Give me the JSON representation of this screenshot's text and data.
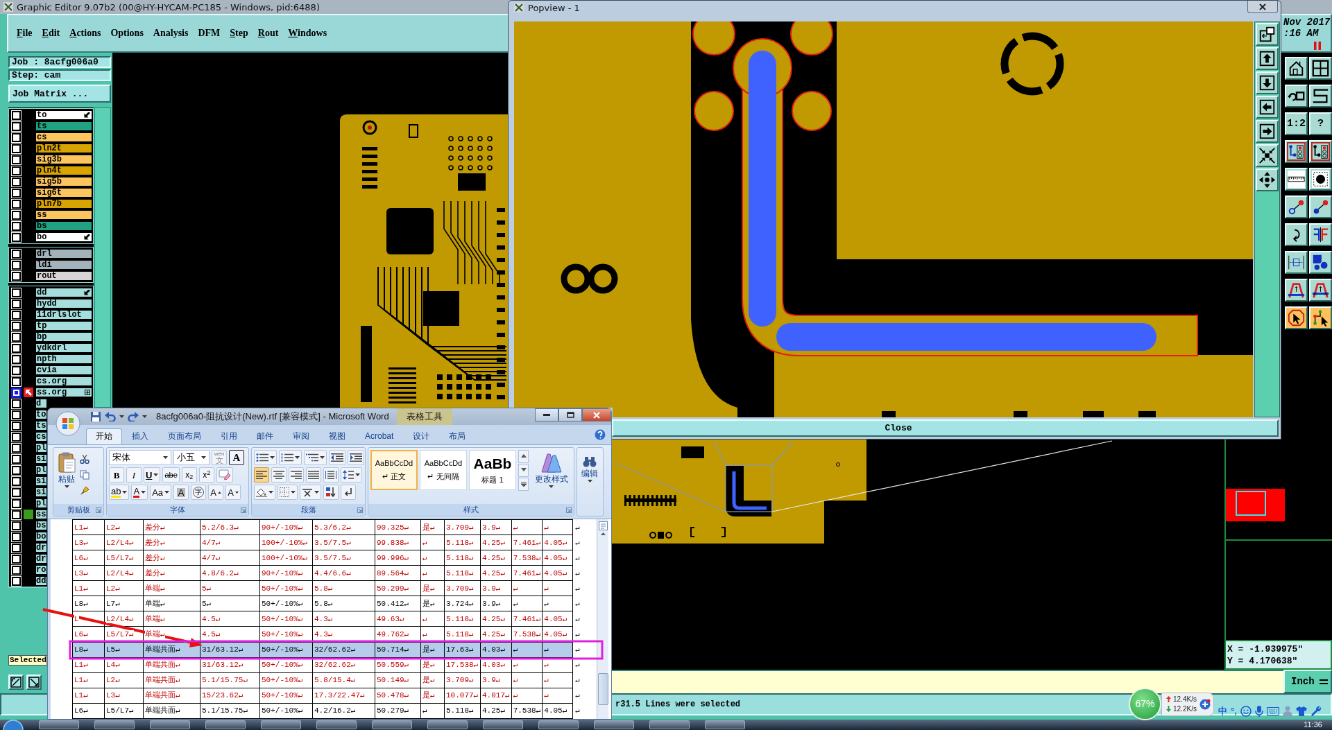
{
  "editor": {
    "title": "Graphic Editor 9.07b2 (00@HY-HYCAM-PC185 - Windows, pid:6488)",
    "menu": [
      {
        "label": "File",
        "mnemonic": true
      },
      {
        "label": "Edit",
        "mnemonic": true
      },
      {
        "label": "Actions",
        "mnemonic": true
      },
      {
        "label": "Options",
        "mnemonic": false
      },
      {
        "label": "Analysis",
        "mnemonic": false
      },
      {
        "label": "DFM",
        "mnemonic": false
      },
      {
        "label": "Step",
        "mnemonic": true
      },
      {
        "label": "Rout",
        "mnemonic": true
      },
      {
        "label": "Windows",
        "mnemonic": true
      }
    ],
    "clock": [
      "Nov 2017",
      ":16 AM"
    ],
    "job": "Job : 8acfg006a0",
    "step": "Step: cam",
    "job_matrix_button": "Job Matrix ...",
    "layer_groups": [
      {
        "layers": [
          {
            "name": "to",
            "color": "#ffffff",
            "affected": false,
            "kind": "pinned"
          },
          {
            "name": "ts",
            "color": "#1fa382",
            "affected": false,
            "kind": "plain"
          },
          {
            "name": "cs",
            "color": "#fdc55e",
            "affected": false,
            "kind": "plain"
          },
          {
            "name": "pln2t",
            "color": "#d9a400",
            "affected": false,
            "kind": "plain"
          },
          {
            "name": "sig3b",
            "color": "#fdc55e",
            "affected": false,
            "kind": "plain"
          },
          {
            "name": "pln4t",
            "color": "#d9a400",
            "affected": false,
            "kind": "plain"
          },
          {
            "name": "sig5b",
            "color": "#fdc55e",
            "affected": false,
            "kind": "plain"
          },
          {
            "name": "sig6t",
            "color": "#fdc55e",
            "affected": false,
            "kind": "plain"
          },
          {
            "name": "pln7b",
            "color": "#d9a400",
            "affected": false,
            "kind": "plain"
          },
          {
            "name": "ss",
            "color": "#fdc55e",
            "affected": false,
            "kind": "plain"
          },
          {
            "name": "bs",
            "color": "#1fa382",
            "affected": false,
            "kind": "plain"
          },
          {
            "name": "bo",
            "color": "#ffffff",
            "affected": false,
            "kind": "pinned"
          }
        ]
      },
      {
        "layers": [
          {
            "name": "drl",
            "color": "#a3b3bb",
            "affected": false,
            "kind": "plain"
          },
          {
            "name": "ldi",
            "color": "#a3b3bb",
            "affected": false,
            "kind": "plain"
          },
          {
            "name": "rout",
            "color": "#d6d6d6",
            "affected": false,
            "kind": "plain"
          }
        ]
      },
      {
        "layers": [
          {
            "name": "dd",
            "color": "#a6dede",
            "affected": false,
            "kind": "pinned"
          },
          {
            "name": "hydd",
            "color": "#a6dede",
            "affected": false,
            "kind": "plain"
          },
          {
            "name": "11drlslot",
            "color": "#a6dede",
            "affected": false,
            "kind": "plain"
          },
          {
            "name": "tp",
            "color": "#a6dede",
            "affected": false,
            "kind": "plain"
          },
          {
            "name": "bp",
            "color": "#a6dede",
            "affected": false,
            "kind": "plain"
          },
          {
            "name": "ydkdrl",
            "color": "#a6dede",
            "affected": false,
            "kind": "plain"
          },
          {
            "name": "npth",
            "color": "#a6dede",
            "affected": false,
            "kind": "plain"
          },
          {
            "name": "cvia",
            "color": "#a6dede",
            "affected": false,
            "kind": "plain"
          },
          {
            "name": "cs.org",
            "color": "#a6dede",
            "affected": false,
            "kind": "plain"
          },
          {
            "name": "ss.org",
            "color": "#a6dede",
            "affected": true,
            "kind": "work"
          },
          {
            "name": "d",
            "color": "#a6dede",
            "affected": false,
            "kind": "plain"
          },
          {
            "name": "to",
            "color": "#a6dede",
            "affected": false,
            "kind": "plain"
          },
          {
            "name": "ts",
            "color": "#a6dede",
            "affected": false,
            "kind": "plain"
          },
          {
            "name": "cs",
            "color": "#a6dede",
            "affected": false,
            "kind": "plain"
          },
          {
            "name": "pl",
            "color": "#a6dede",
            "affected": false,
            "kind": "plain"
          },
          {
            "name": "si",
            "color": "#a6dede",
            "affected": false,
            "kind": "plain"
          },
          {
            "name": "pl",
            "color": "#a6dede",
            "affected": false,
            "kind": "plain"
          },
          {
            "name": "si",
            "color": "#a6dede",
            "affected": false,
            "kind": "plain"
          },
          {
            "name": "si",
            "color": "#a6dede",
            "affected": false,
            "kind": "plain"
          },
          {
            "name": "pl",
            "color": "#a6dede",
            "affected": false,
            "kind": "plain"
          },
          {
            "name": "ss",
            "color": "#a6dede",
            "affected": false,
            "kind": "shown"
          },
          {
            "name": "bs",
            "color": "#a6dede",
            "affected": false,
            "kind": "plain"
          },
          {
            "name": "bo",
            "color": "#a6dede",
            "affected": false,
            "kind": "plain"
          },
          {
            "name": "dr",
            "color": "#a6dede",
            "affected": false,
            "kind": "plain"
          },
          {
            "name": "dr",
            "color": "#a6dede",
            "affected": false,
            "kind": "plain"
          },
          {
            "name": "ro",
            "color": "#a6dede",
            "affected": false,
            "kind": "plain"
          },
          {
            "name": "dd",
            "color": "#a6dede",
            "affected": false,
            "kind": "plain"
          }
        ]
      }
    ],
    "selected_label": "Selected",
    "tools": [
      {
        "kind": "icon",
        "on": false
      },
      {
        "kind": "icon",
        "on": false
      },
      {
        "kind": "icon",
        "on": false
      },
      {
        "kind": "icon",
        "on": false
      },
      {
        "kind": "text",
        "label": "1:2",
        "on": false
      },
      {
        "kind": "text",
        "label": "?",
        "on": false
      },
      {
        "kind": "icon",
        "on": false
      },
      {
        "kind": "icon",
        "on": false
      },
      {
        "kind": "icon",
        "on": false
      },
      {
        "kind": "icon",
        "on": false
      },
      {
        "kind": "icon",
        "on": false
      },
      {
        "kind": "icon",
        "on": false
      },
      {
        "kind": "icon",
        "on": false
      },
      {
        "kind": "icon",
        "on": false
      },
      {
        "kind": "icon",
        "on": false
      },
      {
        "kind": "icon",
        "on": false
      },
      {
        "kind": "icon",
        "on": false
      },
      {
        "kind": "icon",
        "on": false
      },
      {
        "kind": "icon",
        "on": true
      },
      {
        "kind": "icon",
        "on": true
      }
    ],
    "coordinates": [
      "X = -1.939975\"",
      "Y = 4.170638\""
    ],
    "units_button": "Inch",
    "status": "r31.5 Lines were selected"
  },
  "popview": {
    "title": "Popview - 1",
    "close_button": "Close"
  },
  "word": {
    "title": "8acfg006a0-阻抗设计(New).rtf [兼容模式] - Microsoft Word",
    "context_tab": "表格工具",
    "tabs": [
      {
        "label": "开始",
        "selected": true
      },
      {
        "label": "插入",
        "selected": false
      },
      {
        "label": "页面布局",
        "selected": false
      },
      {
        "label": "引用",
        "selected": false
      },
      {
        "label": "邮件",
        "selected": false
      },
      {
        "label": "审阅",
        "selected": false
      },
      {
        "label": "视图",
        "selected": false
      },
      {
        "label": "Acrobat",
        "selected": false
      },
      {
        "label": "设计",
        "selected": false
      },
      {
        "label": "布局",
        "selected": false
      }
    ],
    "clipboard": {
      "title": "剪贴板",
      "paste": "粘贴"
    },
    "font": {
      "title": "字体",
      "name": "宋体",
      "size": "小五",
      "phonetic": [
        "wén",
        "文"
      ],
      "border_char": "A",
      "row2": [
        "B",
        "I",
        "U",
        "abe",
        "x$_{2}$",
        "x$^{2}$"
      ],
      "row3": [
        "ab",
        "A",
        "Aa",
        "A",
        "字",
        "A",
        "A"
      ]
    },
    "paragraph": {
      "title": "段落",
      "align": [
        {
          "selected": true
        },
        {
          "selected": false
        },
        {
          "selected": false
        },
        {
          "selected": false
        },
        {
          "selected": false
        }
      ]
    },
    "styles": {
      "title": "样式",
      "items": [
        {
          "sample": "AaBbCcDd",
          "name": "↵ 正文",
          "selected": true
        },
        {
          "sample": "AaBbCcDd",
          "name": "↵ 无间隔",
          "selected": false
        },
        {
          "sample": "AaBb",
          "name": "标题 1",
          "selected": false
        }
      ],
      "change": "更改样式"
    },
    "editing": "编辑",
    "table": {
      "rows": [
        {
          "cells": [
            "L1↵",
            "L2↵",
            "差分↵",
            "5.2/6.3↵",
            "90+/-10%↵",
            "5.3/6.2↵",
            "90.325↵",
            "是↵",
            "3.709↵",
            "3.9↵",
            "↵",
            "↵"
          ],
          "end": "↵",
          "color": "#c00000",
          "selected": false
        },
        {
          "cells": [
            "L3↵",
            "L2/L4↵",
            "差分↵",
            "4/7↵",
            "100+/-10%↵",
            "3.5/7.5↵",
            "99.838↵",
            "↵",
            "5.118↵",
            "4.25↵",
            "7.461↵",
            "4.05↵"
          ],
          "end": "↵",
          "color": "#c00000",
          "selected": false
        },
        {
          "cells": [
            "L6↵",
            "L5/L7↵",
            "差分↵",
            "4/7↵",
            "100+/-10%↵",
            "3.5/7.5↵",
            "99.996↵",
            "↵",
            "5.118↵",
            "4.25↵",
            "7.538↵",
            "4.05↵"
          ],
          "end": "↵",
          "color": "#c00000",
          "selected": false
        },
        {
          "cells": [
            "L3↵",
            "L2/L4↵",
            "差分↵",
            "4.8/6.2↵",
            "90+/-10%↵",
            "4.4/6.6↵",
            "89.564↵",
            "↵",
            "5.118↵",
            "4.25↵",
            "7.461↵",
            "4.05↵"
          ],
          "end": "↵",
          "color": "#c00000",
          "selected": false
        },
        {
          "cells": [
            "L1↵",
            "L2↵",
            "单端↵",
            "5↵",
            "50+/-10%↵",
            "5.8↵",
            "50.299↵",
            "是↵",
            "3.709↵",
            "3.9↵",
            "↵",
            "↵"
          ],
          "end": "↵",
          "color": "#c00000",
          "selected": false
        },
        {
          "cells": [
            "L8↵",
            "L7↵",
            "单端↵",
            "5↵",
            "50+/-10%↵",
            "5.8↵",
            "50.412↵",
            "是↵",
            "3.724↵",
            "3.9↵",
            "↵",
            "↵"
          ],
          "end": "↵",
          "color": "#000000",
          "selected": false
        },
        {
          "cells": [
            "L",
            "L2/L4↵",
            "单端↵",
            "4.5↵",
            "50+/-10%↵",
            "4.3↵",
            "49.63↵",
            "↵",
            "5.118↵",
            "4.25↵",
            "7.461↵",
            "4.05↵"
          ],
          "end": "↵",
          "color": "#c00000",
          "selected": false
        },
        {
          "cells": [
            "L6↵",
            "L5/L7↵",
            "单端↵",
            "4.5↵",
            "50+/-10%↵",
            "4.3↵",
            "49.762↵",
            "↵",
            "5.118↵",
            "4.25↵",
            "7.538↵",
            "4.05↵"
          ],
          "end": "↵",
          "color": "#c00000",
          "selected": false
        },
        {
          "cells": [
            "L8↵",
            "L5↵",
            "单端共面↵",
            "31/63.12↵",
            "50+/-10%↵",
            "32/62.62↵",
            "50.714↵",
            "是↵",
            "17.63↵",
            "4.03↵",
            "↵",
            "↵"
          ],
          "end": "↵",
          "color": "#000000",
          "selected": true
        },
        {
          "cells": [
            "L1↵",
            "L4↵",
            "单端共面↵",
            "31/63.12↵",
            "50+/-10%↵",
            "32/62.62↵",
            "50.559↵",
            "是↵",
            "17.538↵",
            "4.03↵",
            "↵",
            "↵"
          ],
          "end": "↵",
          "color": "#c00000",
          "selected": false
        },
        {
          "cells": [
            "L1↵",
            "L2↵",
            "单端共面↵",
            "5.1/15.75↵",
            "50+/-10%↵",
            "5.8/15.4↵",
            "50.149↵",
            "是↵",
            "3.709↵",
            "3.9↵",
            "↵",
            "↵"
          ],
          "end": "↵",
          "color": "#c00000",
          "selected": false
        },
        {
          "cells": [
            "L1↵",
            "L3↵",
            "单端共面↵",
            "15/23.62↵",
            "50+/-10%↵",
            "17.3/22.47↵",
            "50.478↵",
            "是↵",
            "10.077↵",
            "4.017↵",
            "↵",
            "↵"
          ],
          "end": "↵",
          "color": "#c00000",
          "selected": false
        },
        {
          "cells": [
            "L6↵",
            "L5/L7↵",
            "单端共面↵",
            "5.1/15.75↵",
            "50+/-10%↵",
            "4.2/16.2↵",
            "50.279↵",
            "↵",
            "5.118↵",
            "4.25↵",
            "7.538↵",
            "4.05↵"
          ],
          "end": "↵",
          "color": "#000000",
          "selected": false
        }
      ]
    }
  },
  "annotations": [
    {
      "kind": "arrow"
    },
    {
      "kind": "frame"
    }
  ],
  "tray": {
    "cpu": "67%",
    "upload": "12.4K/s",
    "download": "12.2K/s",
    "ime": "中",
    "punctuation": "°,",
    "clock": "11:36"
  }
}
